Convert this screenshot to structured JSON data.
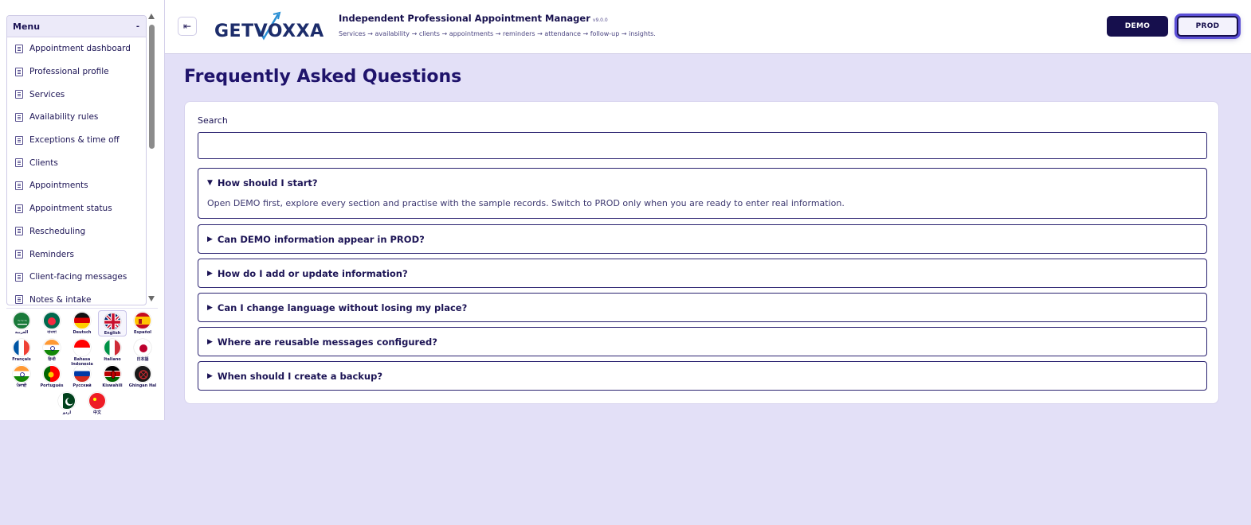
{
  "sidebar": {
    "menu_title": "Menu",
    "menu_toggle": "-",
    "items": [
      {
        "label": "Appointment dashboard"
      },
      {
        "label": "Professional profile"
      },
      {
        "label": "Services"
      },
      {
        "label": "Availability rules"
      },
      {
        "label": "Exceptions & time off"
      },
      {
        "label": "Clients"
      },
      {
        "label": "Appointments"
      },
      {
        "label": "Appointment status"
      },
      {
        "label": "Rescheduling"
      },
      {
        "label": "Reminders"
      },
      {
        "label": "Client-facing messages"
      },
      {
        "label": "Notes & intake"
      }
    ],
    "languages": [
      {
        "label": "العربية",
        "flag": "saudi-arabia-flag"
      },
      {
        "label": "বাংলা",
        "flag": "bangladesh-flag"
      },
      {
        "label": "Deutsch",
        "flag": "germany-flag"
      },
      {
        "label": "English",
        "flag": "uk-flag",
        "selected": true
      },
      {
        "label": "Español",
        "flag": "spain-flag"
      },
      {
        "label": "Français",
        "flag": "france-flag"
      },
      {
        "label": "हिन्दी",
        "flag": "india-flag"
      },
      {
        "label": "Bahasa Indonesia",
        "flag": "indonesia-flag"
      },
      {
        "label": "Italiano",
        "flag": "italy-flag"
      },
      {
        "label": "日本語",
        "flag": "japan-flag"
      },
      {
        "label": "ਪੰਜਾਬੀ",
        "flag": "india-flag"
      },
      {
        "label": "Português",
        "flag": "portugal-flag"
      },
      {
        "label": "Русский",
        "flag": "russia-flag"
      },
      {
        "label": "Kiswahili",
        "flag": "kenya-flag"
      },
      {
        "label": "Ghingan Hal",
        "flag": "dark-emblem-flag"
      },
      {
        "label": "اردو",
        "flag": "pakistan-flag"
      },
      {
        "label": "中文",
        "flag": "china-flag"
      }
    ]
  },
  "header": {
    "logo_text": "GETVOXXA",
    "app_title": "Independent Professional Appointment Manager",
    "version": "v9.0.0",
    "tagline": "Services → availability → clients → appointments → reminders → attendance → follow-up → insights.",
    "demo_label": "DEMO",
    "prod_label": "PROD",
    "collapse_icon": "collapse-sidebar-icon"
  },
  "main": {
    "page_title": "Frequently Asked Questions",
    "search_label": "Search",
    "search_value": "",
    "faqs": [
      {
        "question": "How should I start?",
        "expanded": true,
        "answer": "Open DEMO first, explore every section and practise with the sample records. Switch to PROD only when you are ready to enter real information."
      },
      {
        "question": "Can DEMO information appear in PROD?",
        "expanded": false
      },
      {
        "question": "How do I add or update information?",
        "expanded": false
      },
      {
        "question": "Can I change language without losing my place?",
        "expanded": false
      },
      {
        "question": "Where are reusable messages configured?",
        "expanded": false
      },
      {
        "question": "When should I create a backup?",
        "expanded": false
      }
    ]
  },
  "colors": {
    "brand_navy": "#160f4d",
    "page_background": "#e3e0f7",
    "prod_glow": "#5b4fd6"
  }
}
